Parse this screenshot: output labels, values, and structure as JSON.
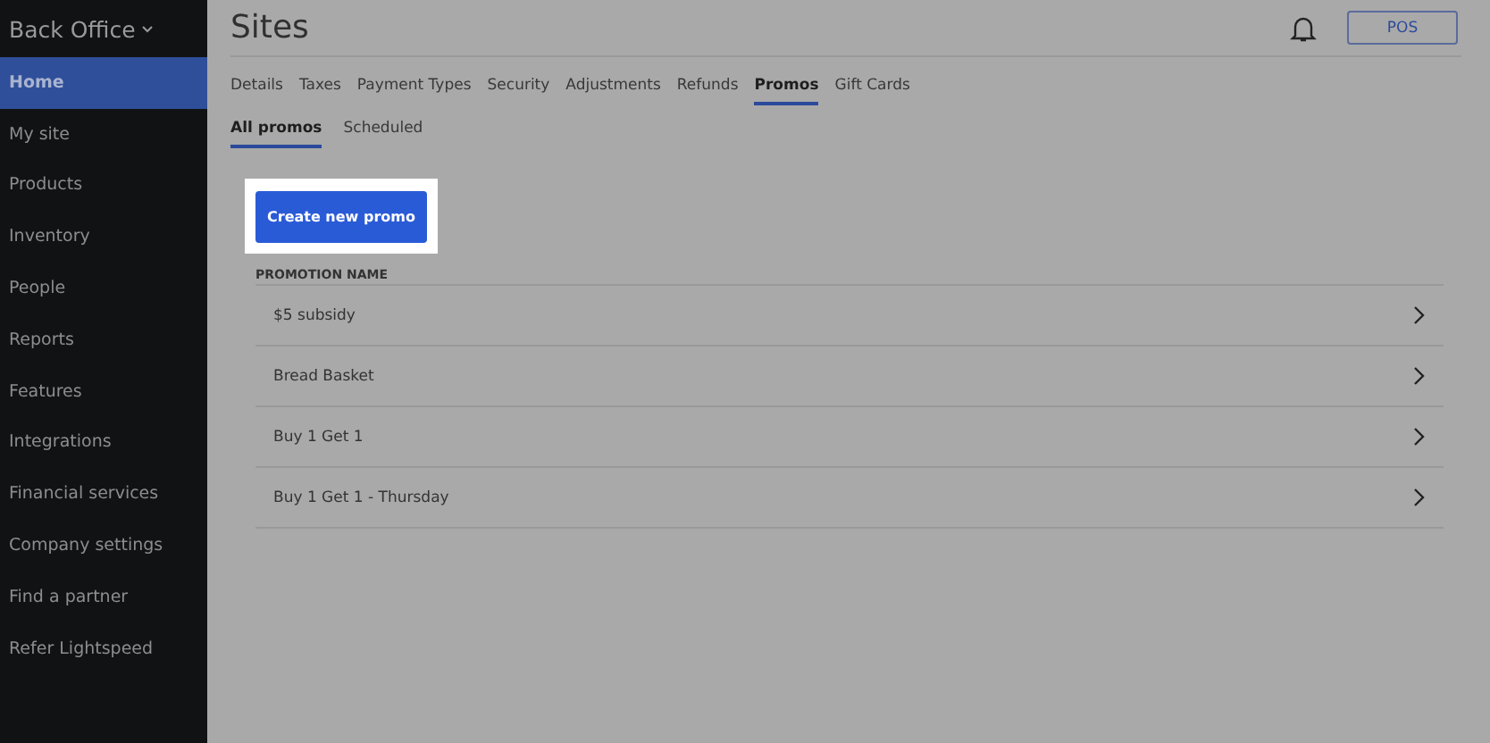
{
  "sidebar": {
    "title": "Back Office",
    "items": [
      {
        "label": "Home",
        "selected": true
      },
      {
        "label": "My site",
        "selected": false
      },
      {
        "label": "Products",
        "selected": false
      },
      {
        "label": "Inventory",
        "selected": false
      },
      {
        "label": "People",
        "selected": false
      },
      {
        "label": "Reports",
        "selected": false
      },
      {
        "label": "Features",
        "selected": false
      },
      {
        "label": "Integrations",
        "selected": false
      },
      {
        "label": "Financial services",
        "selected": false
      },
      {
        "label": "Company settings",
        "selected": false
      },
      {
        "label": "Find a partner",
        "selected": false
      },
      {
        "label": "Refer Lightspeed",
        "selected": false
      }
    ]
  },
  "header": {
    "title": "Sites",
    "pos_button": "POS"
  },
  "tabs": [
    {
      "label": "Details",
      "selected": false
    },
    {
      "label": "Taxes",
      "selected": false
    },
    {
      "label": "Payment Types",
      "selected": false
    },
    {
      "label": "Security",
      "selected": false
    },
    {
      "label": "Adjustments",
      "selected": false
    },
    {
      "label": "Refunds",
      "selected": false
    },
    {
      "label": "Promos",
      "selected": true
    },
    {
      "label": "Gift Cards",
      "selected": false
    }
  ],
  "subtabs": [
    {
      "label": "All promos",
      "selected": true
    },
    {
      "label": "Scheduled",
      "selected": false
    }
  ],
  "create_button": "Create new promo",
  "table": {
    "column": "PROMOTION NAME",
    "rows": [
      "$5 subsidy",
      "Bread Basket",
      "Buy 1 Get 1",
      "Buy 1 Get 1 - Thursday"
    ]
  }
}
